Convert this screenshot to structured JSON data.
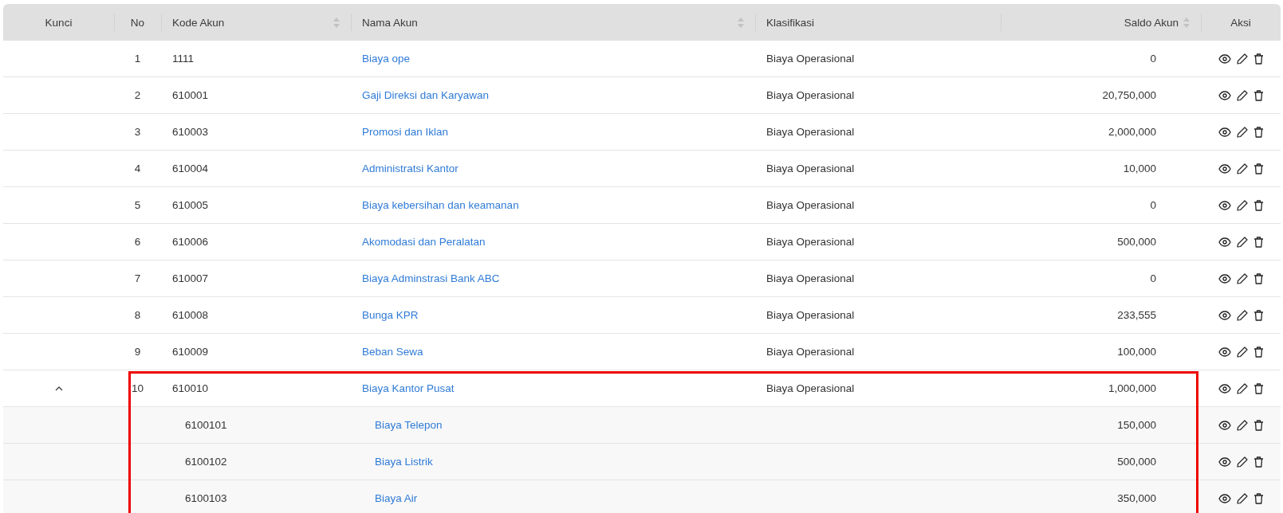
{
  "table": {
    "columns": [
      {
        "label": "Kunci",
        "sortable": false
      },
      {
        "label": "No",
        "sortable": false
      },
      {
        "label": "Kode Akun",
        "sortable": true
      },
      {
        "label": "Nama Akun",
        "sortable": true
      },
      {
        "label": "Klasifikasi",
        "sortable": false
      },
      {
        "label": "Saldo Akun",
        "sortable": true
      },
      {
        "label": "Aksi",
        "sortable": false
      }
    ],
    "rows": [
      {
        "no": "1",
        "code": "1111",
        "name": "Biaya ope",
        "classification": "Biaya Operasional",
        "balance": "0",
        "highlighted": false
      },
      {
        "no": "2",
        "code": "610001",
        "name": "Gaji Direksi dan Karyawan",
        "classification": "Biaya Operasional",
        "balance": "20,750,000",
        "highlighted": false
      },
      {
        "no": "3",
        "code": "610003",
        "name": "Promosi dan Iklan",
        "classification": "Biaya Operasional",
        "balance": "2,000,000",
        "highlighted": false
      },
      {
        "no": "4",
        "code": "610004",
        "name": "Administratsi Kantor",
        "classification": "Biaya Operasional",
        "balance": "10,000",
        "highlighted": false
      },
      {
        "no": "5",
        "code": "610005",
        "name": "Biaya kebersihan dan keamanan",
        "classification": "Biaya Operasional",
        "balance": "0",
        "highlighted": false
      },
      {
        "no": "6",
        "code": "610006",
        "name": "Akomodasi dan Peralatan",
        "classification": "Biaya Operasional",
        "balance": "500,000",
        "highlighted": false
      },
      {
        "no": "7",
        "code": "610007",
        "name": "Biaya Adminstrasi Bank ABC",
        "classification": "Biaya Operasional",
        "balance": "0",
        "highlighted": false
      },
      {
        "no": "8",
        "code": "610008",
        "name": "Bunga KPR",
        "classification": "Biaya Operasional",
        "balance": "233,555",
        "highlighted": false
      },
      {
        "no": "9",
        "code": "610009",
        "name": "Beban Sewa",
        "classification": "Biaya Operasional",
        "balance": "100,000",
        "highlighted": false
      },
      {
        "no": "10",
        "code": "610010",
        "name": "Biaya Kantor Pusat",
        "classification": "Biaya Operasional",
        "balance": "1,000,000",
        "highlighted": true,
        "expanded": true,
        "children": [
          {
            "code": "6100101",
            "name": "Biaya Telepon",
            "balance": "150,000"
          },
          {
            "code": "6100102",
            "name": "Biaya Listrik",
            "balance": "500,000"
          },
          {
            "code": "6100103",
            "name": "Biaya Air",
            "balance": "350,000"
          }
        ]
      }
    ]
  }
}
